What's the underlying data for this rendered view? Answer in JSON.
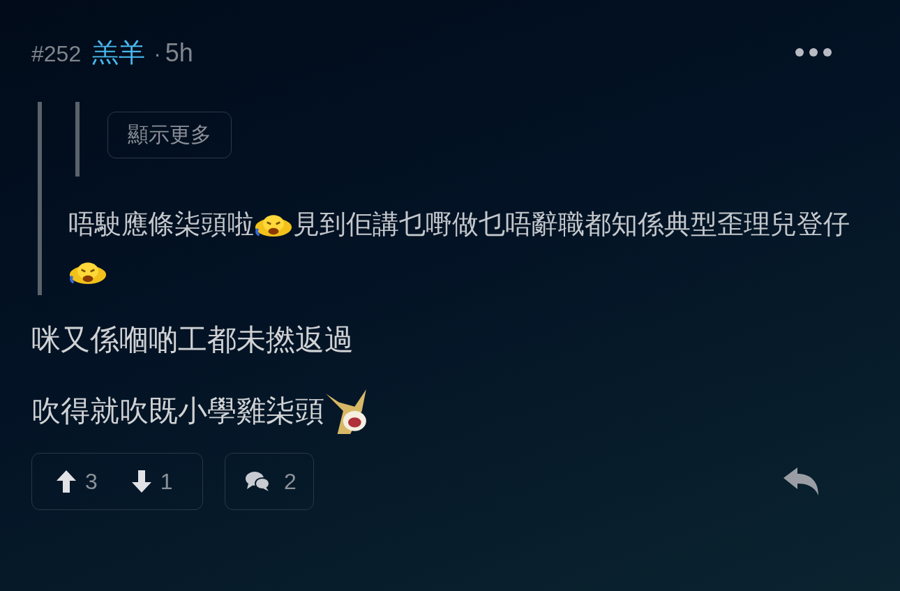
{
  "post": {
    "number": "#252",
    "author": "羔羊",
    "separator": "·",
    "time": "5h"
  },
  "quote": {
    "show_more": "顯示更多",
    "paragraph": [
      {
        "kind": "text",
        "text": "唔駛應條柒頭啦"
      },
      {
        "kind": "laugh"
      },
      {
        "kind": "text",
        "text": "見到佢講乜嘢做乜唔辭職都知係典型歪理兒登仔"
      },
      {
        "kind": "laugh"
      }
    ]
  },
  "body": [
    [
      {
        "kind": "text",
        "text": "咪又係嗰啲工都未撚返過"
      }
    ],
    [
      {
        "kind": "text",
        "text": "吹得就吹既小學雞柒頭"
      },
      {
        "kind": "fox"
      }
    ]
  ],
  "actions": {
    "upvotes": "3",
    "downvotes": "1",
    "comments": "2"
  }
}
